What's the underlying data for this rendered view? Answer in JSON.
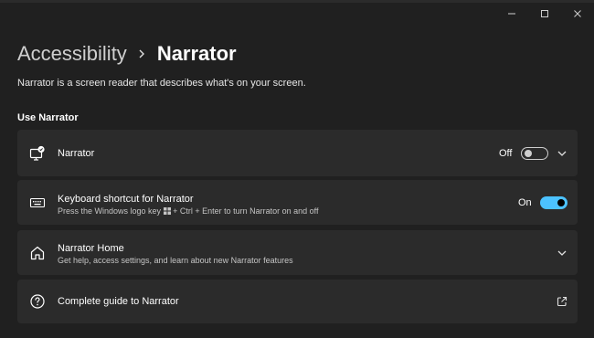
{
  "window": {
    "minimize_icon": "minimize-icon",
    "maximize_icon": "maximize-icon",
    "close_icon": "close-icon"
  },
  "breadcrumb": {
    "parent": "Accessibility",
    "separator_icon": "chevron-right-icon",
    "current": "Narrator"
  },
  "description": "Narrator is a screen reader that describes what's on your screen.",
  "section": {
    "heading": "Use Narrator"
  },
  "settings": [
    {
      "title": "Narrator",
      "icon": "narrator-monitor-icon",
      "state_label": "Off",
      "toggle_on": false,
      "trailing_icon": "chevron-down-icon"
    },
    {
      "title": "Keyboard shortcut for Narrator",
      "subtitle_before": "Press the Windows logo key",
      "subtitle_after": "+ Ctrl + Enter to turn Narrator on and off",
      "icon": "keyboard-icon",
      "state_label": "On",
      "toggle_on": true
    },
    {
      "title": "Narrator Home",
      "subtitle": "Get help, access settings, and learn about new Narrator features",
      "icon": "home-icon",
      "trailing_icon": "chevron-down-icon"
    },
    {
      "title": "Complete guide to Narrator",
      "icon": "help-icon",
      "trailing_icon": "open-external-icon"
    }
  ],
  "colors": {
    "background": "#202020",
    "card": "#2b2b2b",
    "accent": "#4cc2ff",
    "secondary_text": "#c5c5c5"
  }
}
